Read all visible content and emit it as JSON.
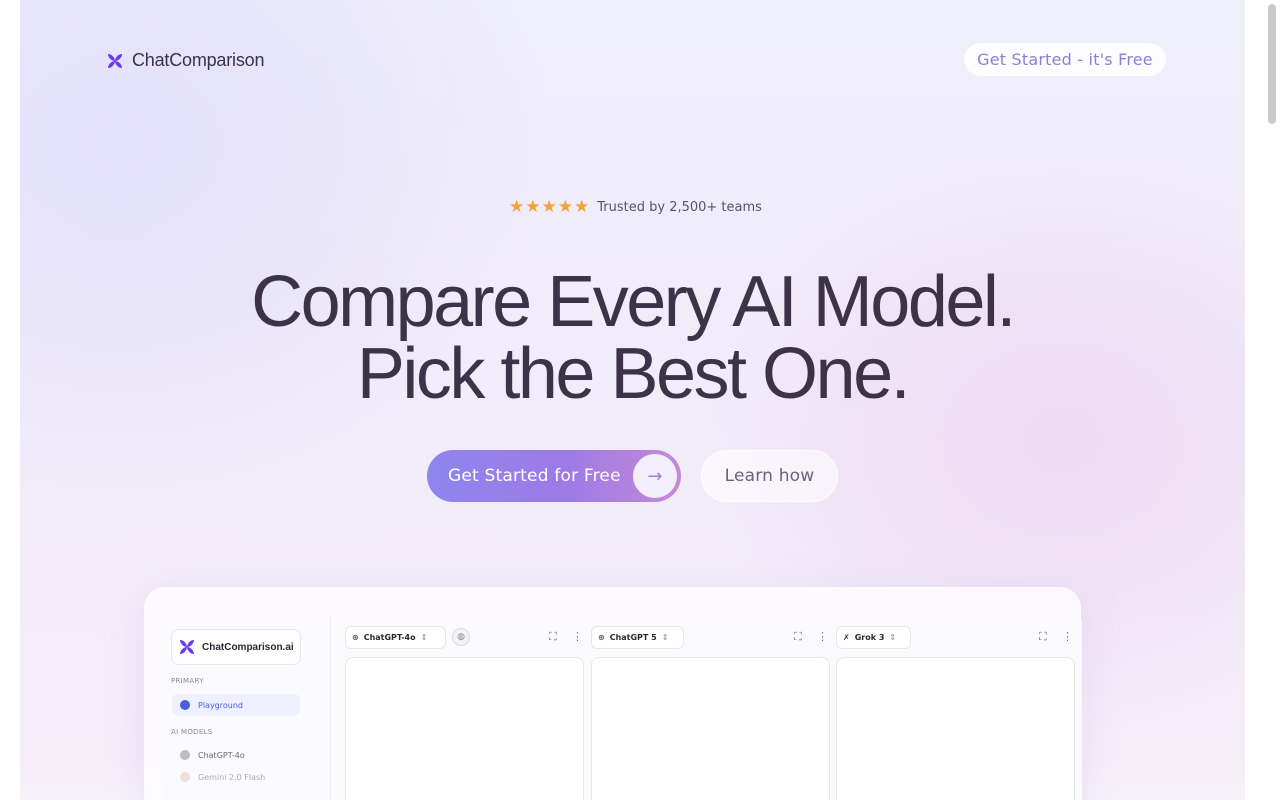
{
  "header": {
    "brand": "ChatComparison",
    "cta": "Get Started - it's Free"
  },
  "hero": {
    "rating_stars": 5,
    "trust_text": "Trusted by 2,500+ teams",
    "headline_line1": "Compare Every AI Model.",
    "headline_line2": "Pick the Best One.",
    "primary_cta": "Get Started for Free",
    "secondary_cta": "Learn how"
  },
  "preview": {
    "brand": "ChatComparison.ai",
    "primary_section": "PRIMARY",
    "playground": "Playground",
    "models_section": "AI MODELS",
    "models": [
      "ChatGPT-4o",
      "Gemini 2.0 Flash"
    ],
    "columns": [
      {
        "model": "ChatGPT-4o"
      },
      {
        "model": "ChatGPT 5"
      },
      {
        "model": "Grok 3"
      }
    ]
  },
  "colors": {
    "brand_purple": "#6a3cf0",
    "accent": "#8f86ef",
    "star": "#f2a33a"
  }
}
